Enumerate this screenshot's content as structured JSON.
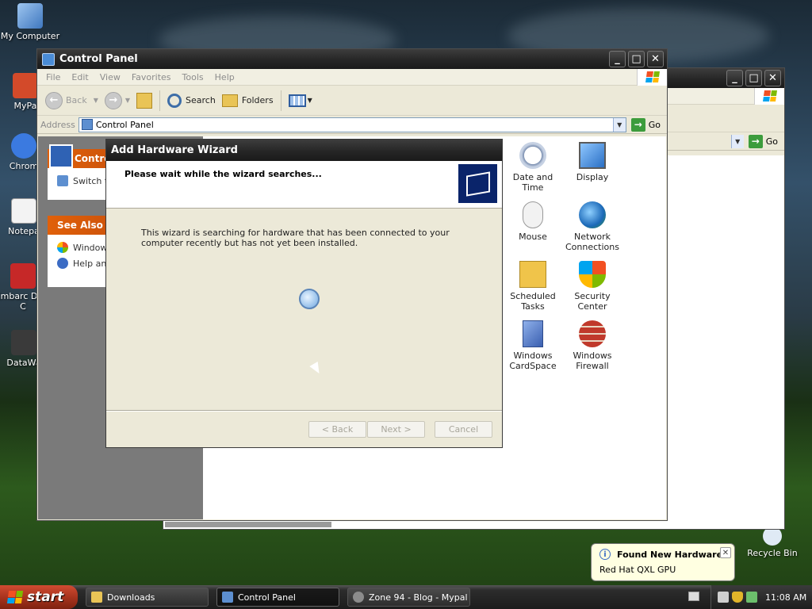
{
  "desktop": {
    "icons": [
      {
        "label": "My Computer"
      },
      {
        "label": "MyPa"
      },
      {
        "label": "Chrom"
      },
      {
        "label": "Notepa"
      },
      {
        "label": "Embarc Dev-C"
      },
      {
        "label": "DataWa"
      },
      {
        "label": "Recycle Bin"
      }
    ]
  },
  "back_window": {
    "address_go": "Go"
  },
  "control_panel": {
    "title": "Control Panel",
    "menu": [
      "File",
      "Edit",
      "View",
      "Favorites",
      "Tools",
      "Help"
    ],
    "toolbar": {
      "back": "Back",
      "search": "Search",
      "folders": "Folders"
    },
    "address": {
      "label": "Address",
      "value": "Control Panel",
      "go": "Go"
    },
    "sidebar": {
      "panel1_title": "Contro",
      "panel1_item": "Switch t",
      "see_also_title": "See Also",
      "see_also_items": [
        "Window",
        "Help an"
      ]
    },
    "icons": [
      {
        "label": "Date and Time"
      },
      {
        "label": "Display"
      },
      {
        "label": "Mouse"
      },
      {
        "label": "Network Connections"
      },
      {
        "label": "Scheduled Tasks"
      },
      {
        "label": "Security Center"
      },
      {
        "label": "Windows CardSpace"
      },
      {
        "label": "Windows Firewall"
      }
    ]
  },
  "wizard": {
    "title": "Add Hardware Wizard",
    "heading": "Please wait while the wizard searches...",
    "body": "This wizard is searching for hardware that has been connected to your computer recently but has not yet been installed.",
    "buttons": {
      "back": "< Back",
      "next": "Next >",
      "cancel": "Cancel"
    }
  },
  "balloon": {
    "title": "Found New Hardware",
    "text": "Red Hat QXL GPU"
  },
  "taskbar": {
    "start": "start",
    "tasks": [
      {
        "label": "Downloads"
      },
      {
        "label": "Control Panel"
      },
      {
        "label": "Zone 94 - Blog - Mypal"
      }
    ],
    "clock": "11:08 AM"
  },
  "colors": {
    "title_bar": "#262626",
    "start_button": "#a8341e",
    "panel_header": "#e0600a",
    "balloon_bg": "#ffffe1"
  }
}
